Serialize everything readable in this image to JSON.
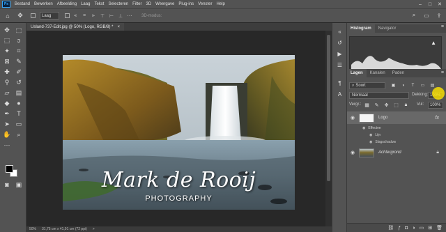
{
  "menubar": {
    "logo": "Ps",
    "items": [
      "Bestand",
      "Bewerken",
      "Afbeelding",
      "Laag",
      "Tekst",
      "Selecteren",
      "Filter",
      "3D",
      "Weergave",
      "Plug-ins",
      "Venster",
      "Help"
    ],
    "controls": [
      "–",
      "□",
      "✕"
    ]
  },
  "optionsbar": {
    "auto_select_value": "Laag",
    "transform_label": "3D-modus:"
  },
  "document": {
    "tab_title": "Usland-737-Edit.jpg @ 50% (Logo, RGB/8) *",
    "tab_close": "×",
    "status_zoom": "50%",
    "status_size": "31,75 cm x 41,91 cm (72 ppi)",
    "status_arrow": ">"
  },
  "logo": {
    "name": "Mark de Rooij",
    "subtitle": "PHOTOGRAPHY"
  },
  "panels": {
    "top_tabs": [
      "Histogram",
      "Navigator"
    ],
    "layer_tabs": [
      "Lagen",
      "Kanalen",
      "Paden"
    ],
    "kind_label": "Soort",
    "blend_mode": "Normaal",
    "opacity_label": "Dekking:",
    "opacity_value": "100%",
    "lock_label": "Vergr.:",
    "fill_label": "Vul:",
    "fill_value": "100%",
    "layers": [
      {
        "name": "Logo",
        "fx": "fx",
        "effects_label": "Effecten",
        "effects": [
          "Lijn",
          "Slagschaduw"
        ]
      },
      {
        "name": "Achtergrond"
      }
    ]
  },
  "colors": {
    "accent": "#31a8ff",
    "cursor_highlight": "#ffe600"
  }
}
